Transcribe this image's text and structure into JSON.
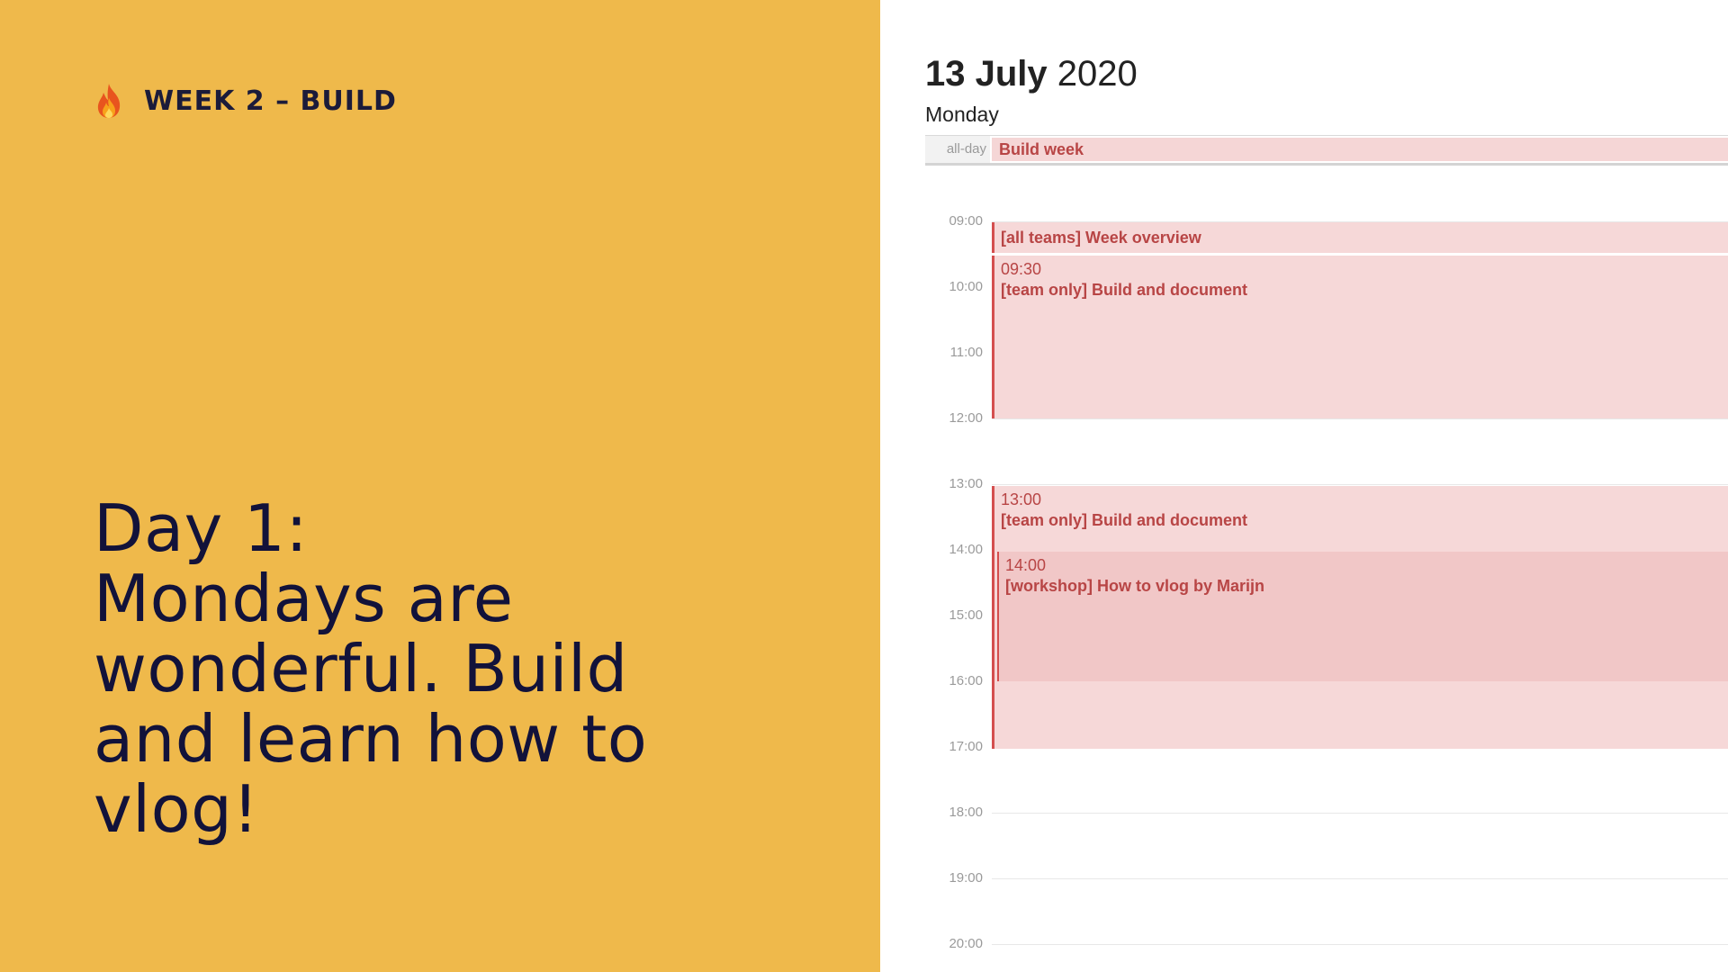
{
  "left": {
    "week_label": "WEEK 2 – BUILD",
    "headline_lines": [
      "Day 1:",
      "Mondays are",
      "wonderful. Build",
      "and learn how to",
      "vlog!"
    ],
    "background_color": "#efb94b",
    "text_color": "#12123a",
    "icon": "fire-icon"
  },
  "calendar": {
    "date_day": "13 July",
    "date_year": "2020",
    "weekday": "Monday",
    "allday_label": "all-day",
    "allday_event": "Build week",
    "hours": [
      "09:00",
      "10:00",
      "11:00",
      "12:00",
      "13:00",
      "14:00",
      "15:00",
      "16:00",
      "17:00",
      "18:00",
      "19:00",
      "20:00"
    ],
    "events": [
      {
        "time": "",
        "title": "[all teams] Week overview"
      },
      {
        "time": "09:30",
        "title": "[team only] Build and document"
      },
      {
        "time": "13:00",
        "title": "[team only] Build and document"
      },
      {
        "time": "14:00",
        "title": "[workshop] How to vlog by Marijn"
      }
    ],
    "event_color": "#b84545",
    "event_bg": "#f6d8d8"
  }
}
